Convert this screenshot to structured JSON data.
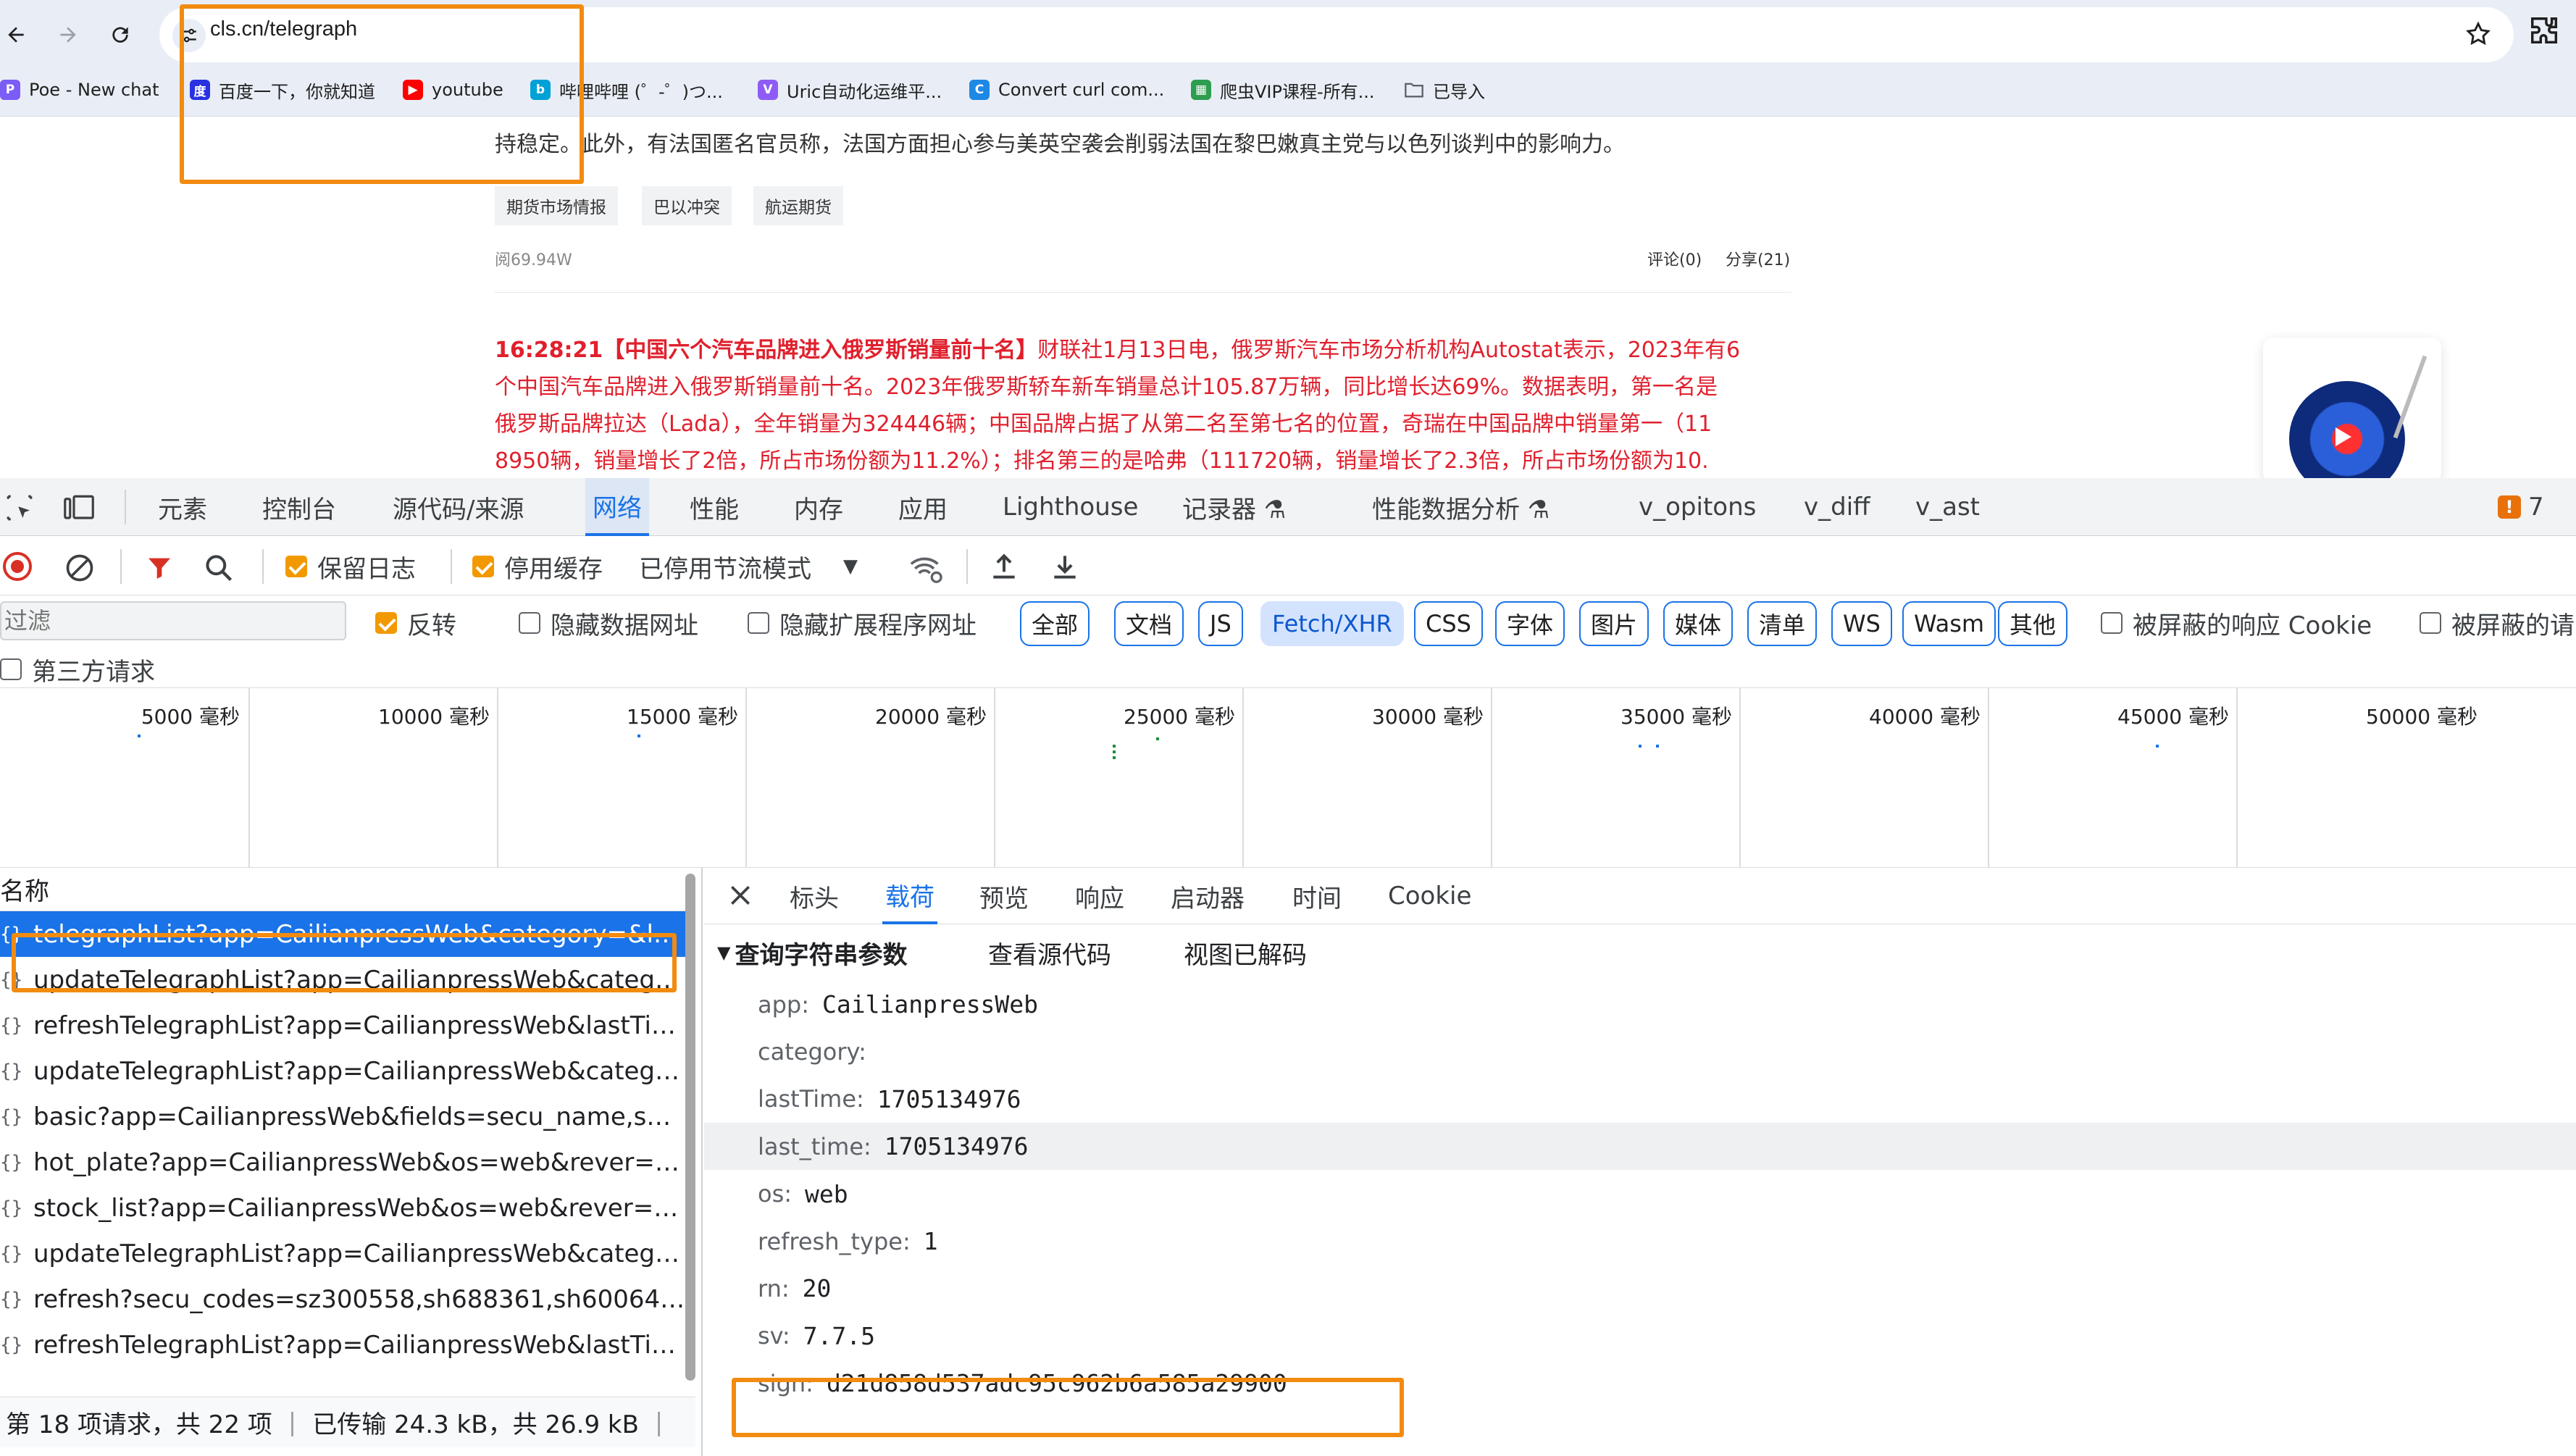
{
  "browser": {
    "url": "cls.cn/telegraph",
    "bookmarks": [
      {
        "icon": "poe-icon",
        "label": "Poe - New chat",
        "color": "#7b5cf5",
        "glyph": "P"
      },
      {
        "icon": "baidu-icon",
        "label": "百度一下，你就知道",
        "color": "#2932e1",
        "glyph": "度"
      },
      {
        "icon": "youtube-icon",
        "label": "youtube",
        "color": "#ff0000",
        "glyph": "▶"
      },
      {
        "icon": "bilibili-icon",
        "label": "哔哩哔哩 (゜-゜)つ...",
        "color": "#00a1d6",
        "glyph": "b"
      },
      {
        "icon": "uric-icon",
        "label": "Uric自动化运维平...",
        "color": "#8e5cf5",
        "glyph": "V"
      },
      {
        "icon": "curl-converter-icon",
        "label": "Convert curl com...",
        "color": "#1e88e5",
        "glyph": "C"
      },
      {
        "icon": "course-icon",
        "label": "爬虫VIP课程-所有...",
        "color": "#2e9d4f",
        "glyph": "▦"
      },
      {
        "icon": "folder-icon",
        "label": "已导入",
        "color": "#5f6368",
        "glyph": ""
      }
    ]
  },
  "page": {
    "prev_text_line": "持稳定。此外，有法国匿名官员称，法国方面担心参与美英空袭会削弱法国在黎巴嫩真主党与以色列谈判中的影响力。",
    "tags": [
      "期货市场情报",
      "巴以冲突",
      "航运期货"
    ],
    "reads": "阅69.94W",
    "comment": "评论(0)",
    "share": "分享(21)",
    "news_time": "16:28:21",
    "news_title": "【中国六个汽车品牌进入俄罗斯销量前十名】",
    "news_lines": [
      "财联社1月13日电，俄罗斯汽车市场分析机构Autostat表示，2023年有6",
      "个中国汽车品牌进入俄罗斯销量前十名。2023年俄罗斯轿车新车销量总计105.87万辆，同比增长达69%。数据表明，第一名是",
      "俄罗斯品牌拉达（Lada），全年销量为324446辆；中国品牌占据了从第二名至第七名的位置，奇瑞在中国品牌中销量第一（11",
      "8950辆，销量增长了2倍，所占市场份额为11.2%）；排名第三的是哈弗（111720辆，销量增长了2.3倍，所占市场份额为10."
    ]
  },
  "devtools": {
    "tabs": [
      "元素",
      "控制台",
      "源代码/来源",
      "网络",
      "性能",
      "内存",
      "应用",
      "Lighthouse",
      "记录器 ⚗",
      "性能数据分析 ⚗",
      "v_opitons",
      "v_diff",
      "v_ast"
    ],
    "active_tab": "网络",
    "issues_count": "7",
    "toolbar": {
      "preserve_log": "保留日志",
      "disable_cache": "停用缓存",
      "throttle": "已停用节流模式"
    },
    "filter": {
      "placeholder": "过滤",
      "invert": "反转",
      "hide_data_urls": "隐藏数据网址",
      "hide_ext_urls": "隐藏扩展程序网址",
      "types": [
        "全部",
        "文档",
        "JS",
        "Fetch/XHR",
        "CSS",
        "字体",
        "图片",
        "媒体",
        "清单",
        "WS",
        "Wasm",
        "其他"
      ],
      "selected_type": "Fetch/XHR",
      "blocked_cookies": "被屏蔽的响应 Cookie",
      "blocked_requests": "被屏蔽的请",
      "third_party": "第三方请求"
    },
    "timeline_ticks": [
      "5000 毫秒",
      "10000 毫秒",
      "15000 毫秒",
      "20000 毫秒",
      "25000 毫秒",
      "30000 毫秒",
      "35000 毫秒",
      "40000 毫秒",
      "45000 毫秒",
      "50000 毫秒"
    ],
    "request_list": {
      "header": "名称",
      "rows": [
        "telegraphList?app=CailianpressWeb&category=&las...",
        "updateTelegraphList?app=CailianpressWeb&catego...",
        "refreshTelegraphList?app=CailianpressWeb&lastTim...",
        "updateTelegraphList?app=CailianpressWeb&catego...",
        "basic?app=CailianpressWeb&fields=secu_name,sec...",
        "hot_plate?app=CailianpressWeb&os=web&rever=1&...",
        "stock_list?app=CailianpressWeb&os=web&rever=1&...",
        "updateTelegraphList?app=CailianpressWeb&catego...",
        "refresh?secu_codes=sz300558,sh688361,sh600642...",
        "refreshTelegraphList?app=CailianpressWeb&lastTim..."
      ],
      "status": "第 18 项请求，共 22 项",
      "transferred": "已传输 24.3 kB，共 26.9 kB"
    },
    "detail": {
      "tabs": [
        "标头",
        "载荷",
        "预览",
        "响应",
        "启动器",
        "时间",
        "Cookie"
      ],
      "active_tab": "载荷",
      "section_title": "查询字符串参数",
      "view_source": "查看源代码",
      "view_decoded": "视图已解码",
      "params": [
        {
          "key": "app:",
          "value": "CailianpressWeb"
        },
        {
          "key": "category:",
          "value": ""
        },
        {
          "key": "lastTime:",
          "value": "1705134976"
        },
        {
          "key": "last_time:",
          "value": "1705134976"
        },
        {
          "key": "os:",
          "value": "web"
        },
        {
          "key": "refresh_type:",
          "value": "1"
        },
        {
          "key": "rn:",
          "value": "20"
        },
        {
          "key": "sv:",
          "value": "7.7.5"
        },
        {
          "key": "sign:",
          "value": "d21d858d537adc95c962b6a585a29900"
        }
      ]
    }
  },
  "colors": {
    "accent": "#1a73e8",
    "highlight_box": "#f28b10",
    "news_red": "#e0202d",
    "checkbox_on": "#f29900"
  }
}
